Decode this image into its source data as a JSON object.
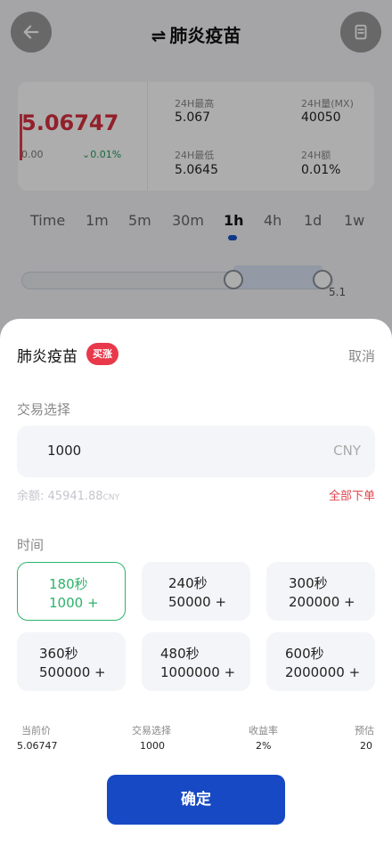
{
  "header": {
    "title": "肺炎疫苗",
    "swap_glyph": "⇌"
  },
  "ticker": {
    "price": "5.06747",
    "base": "0.00",
    "change": "0.01%",
    "high_label": "24H最高",
    "high_value": "5.067",
    "vol_label": "24H量(MX)",
    "vol_value": "40050",
    "low_label": "24H最低",
    "low_value": "5.0645",
    "amount_label": "24H额",
    "amount_value": "0.01%"
  },
  "timeframes": [
    {
      "label": "Time",
      "active": false
    },
    {
      "label": "1m",
      "active": false
    },
    {
      "label": "5m",
      "active": false
    },
    {
      "label": "30m",
      "active": false
    },
    {
      "label": "1h",
      "active": true
    },
    {
      "label": "4h",
      "active": false
    },
    {
      "label": "1d",
      "active": false
    },
    {
      "label": "1w",
      "active": false
    }
  ],
  "range": {
    "value": "5.1"
  },
  "sheet": {
    "title": "肺炎疫苗",
    "badge": "买涨",
    "cancel": "取消",
    "trade_label": "交易选择",
    "amount_value": "1000",
    "currency": "CNY",
    "balance_label": "余额:",
    "balance_value": "45941.88",
    "balance_currency": "CNY",
    "all_in": "全部下单",
    "time_label": "时间",
    "options": [
      {
        "duration": "180秒",
        "amount": "1000 +",
        "selected": true
      },
      {
        "duration": "240秒",
        "amount": "50000 +",
        "selected": false
      },
      {
        "duration": "300秒",
        "amount": "200000 +",
        "selected": false
      },
      {
        "duration": "360秒",
        "amount": "500000 +",
        "selected": false
      },
      {
        "duration": "480秒",
        "amount": "1000000 +",
        "selected": false
      },
      {
        "duration": "600秒",
        "amount": "2000000 +",
        "selected": false
      }
    ],
    "summary": {
      "current_price_label": "当前价",
      "current_price_value": "5.06747",
      "trade_label": "交易选择",
      "trade_value": "1000",
      "yield_label": "收益率",
      "yield_value": "2%",
      "estimate_label": "预估",
      "estimate_value": "20"
    },
    "confirm": "确定"
  },
  "colors": {
    "accent_blue": "#1649c3",
    "up_red": "#d8303f",
    "badge_red": "#e8384a",
    "selected_green": "#2db26a",
    "change_green": "#1e9c5a"
  },
  "icons": {
    "back": "arrow-left-icon",
    "doc": "document-icon"
  }
}
